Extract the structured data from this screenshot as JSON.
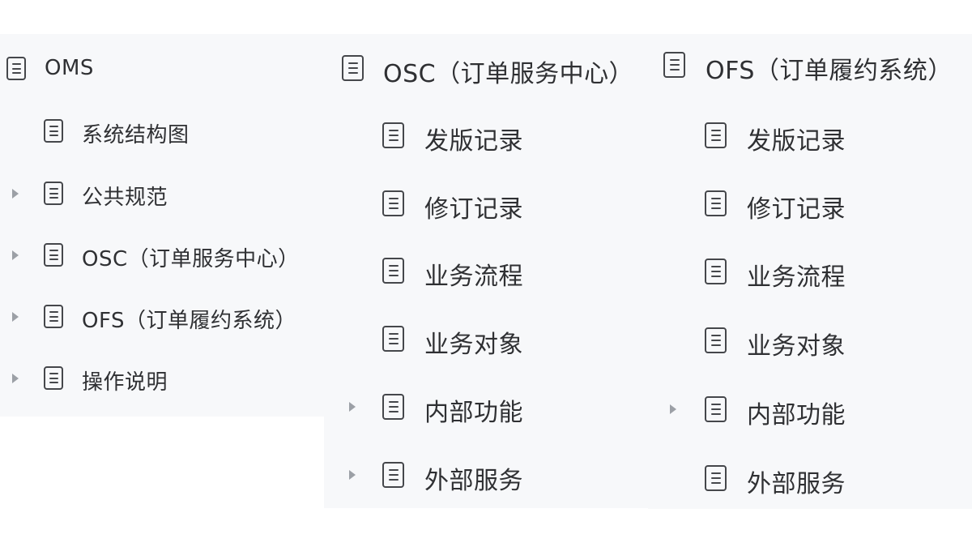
{
  "panels": [
    {
      "root": "OMS",
      "items": [
        {
          "label": "系统结构图",
          "expandable": false
        },
        {
          "label": "公共规范",
          "expandable": true
        },
        {
          "label": "OSC（订单服务中心）",
          "expandable": true
        },
        {
          "label": "OFS（订单履约系统）",
          "expandable": true
        },
        {
          "label": "操作说明",
          "expandable": true
        }
      ]
    },
    {
      "root": "OSC（订单服务中心）",
      "items": [
        {
          "label": "发版记录",
          "expandable": false
        },
        {
          "label": "修订记录",
          "expandable": false
        },
        {
          "label": "业务流程",
          "expandable": false
        },
        {
          "label": "业务对象",
          "expandable": false
        },
        {
          "label": "内部功能",
          "expandable": true
        },
        {
          "label": "外部服务",
          "expandable": true
        }
      ]
    },
    {
      "root": "OFS（订单履约系统）",
      "items": [
        {
          "label": "发版记录",
          "expandable": false
        },
        {
          "label": "修订记录",
          "expandable": false
        },
        {
          "label": "业务流程",
          "expandable": false
        },
        {
          "label": "业务对象",
          "expandable": false
        },
        {
          "label": "内部功能",
          "expandable": true
        },
        {
          "label": "外部服务",
          "expandable": false
        }
      ]
    }
  ],
  "icons": {
    "document": "document-icon",
    "expand": "caret-right-icon"
  },
  "colors": {
    "panel_background": "#f7f8fa",
    "text": "#2f3033",
    "icon": "#45474b",
    "caret": "#9ca0a6"
  }
}
